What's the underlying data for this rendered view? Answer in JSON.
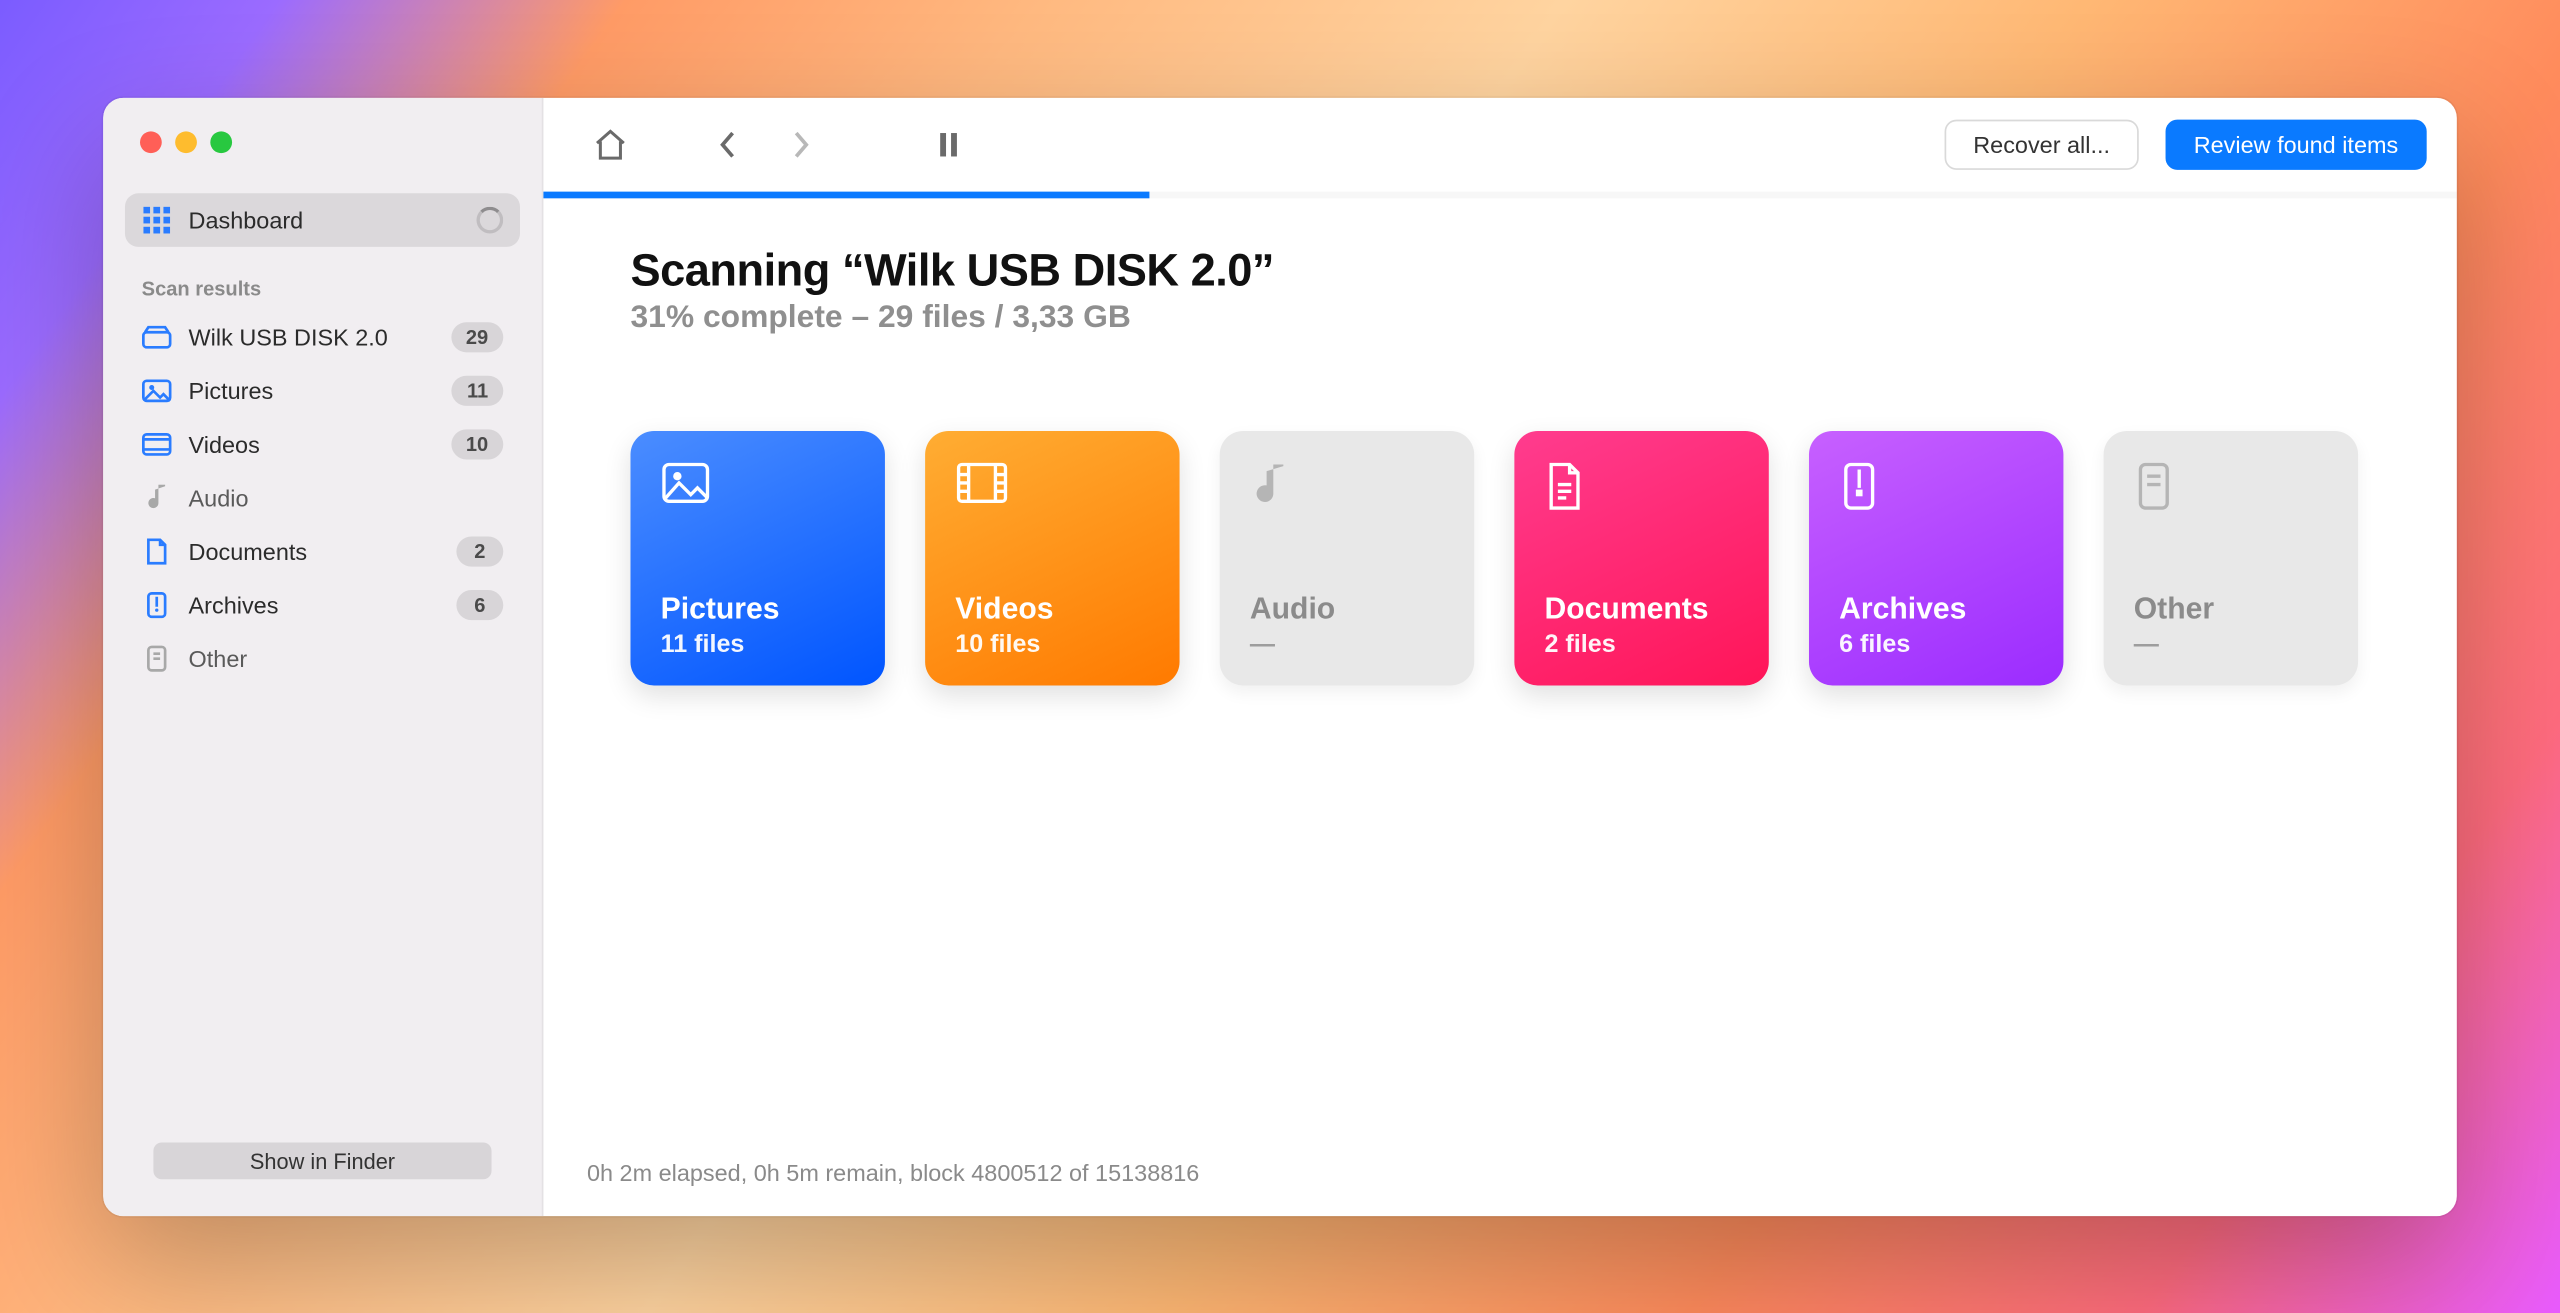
{
  "sidebar": {
    "dashboard_label": "Dashboard",
    "section_label": "Scan results",
    "items": [
      {
        "label": "Wilk USB DISK 2.0",
        "count": "29"
      },
      {
        "label": "Pictures",
        "count": "11"
      },
      {
        "label": "Videos",
        "count": "10"
      },
      {
        "label": "Audio",
        "count": ""
      },
      {
        "label": "Documents",
        "count": "2"
      },
      {
        "label": "Archives",
        "count": "6"
      },
      {
        "label": "Other",
        "count": ""
      }
    ],
    "footer_button": "Show in Finder"
  },
  "toolbar": {
    "recover_label": "Recover all...",
    "review_label": "Review found items"
  },
  "scan": {
    "title": "Scanning “Wilk USB DISK 2.0”",
    "subtitle": "31% complete – 29 files / 3,33 GB",
    "progress_percent": 31
  },
  "cards": [
    {
      "name": "Pictures",
      "count": "11 files",
      "kind": "pictures"
    },
    {
      "name": "Videos",
      "count": "10 files",
      "kind": "videos"
    },
    {
      "name": "Audio",
      "count": "—",
      "kind": "audio-empty"
    },
    {
      "name": "Documents",
      "count": "2 files",
      "kind": "documents"
    },
    {
      "name": "Archives",
      "count": "6 files",
      "kind": "archives"
    },
    {
      "name": "Other",
      "count": "—",
      "kind": "other-empty"
    }
  ],
  "status": "0h 2m elapsed, 0h 5m remain, block 4800512 of 15138816"
}
